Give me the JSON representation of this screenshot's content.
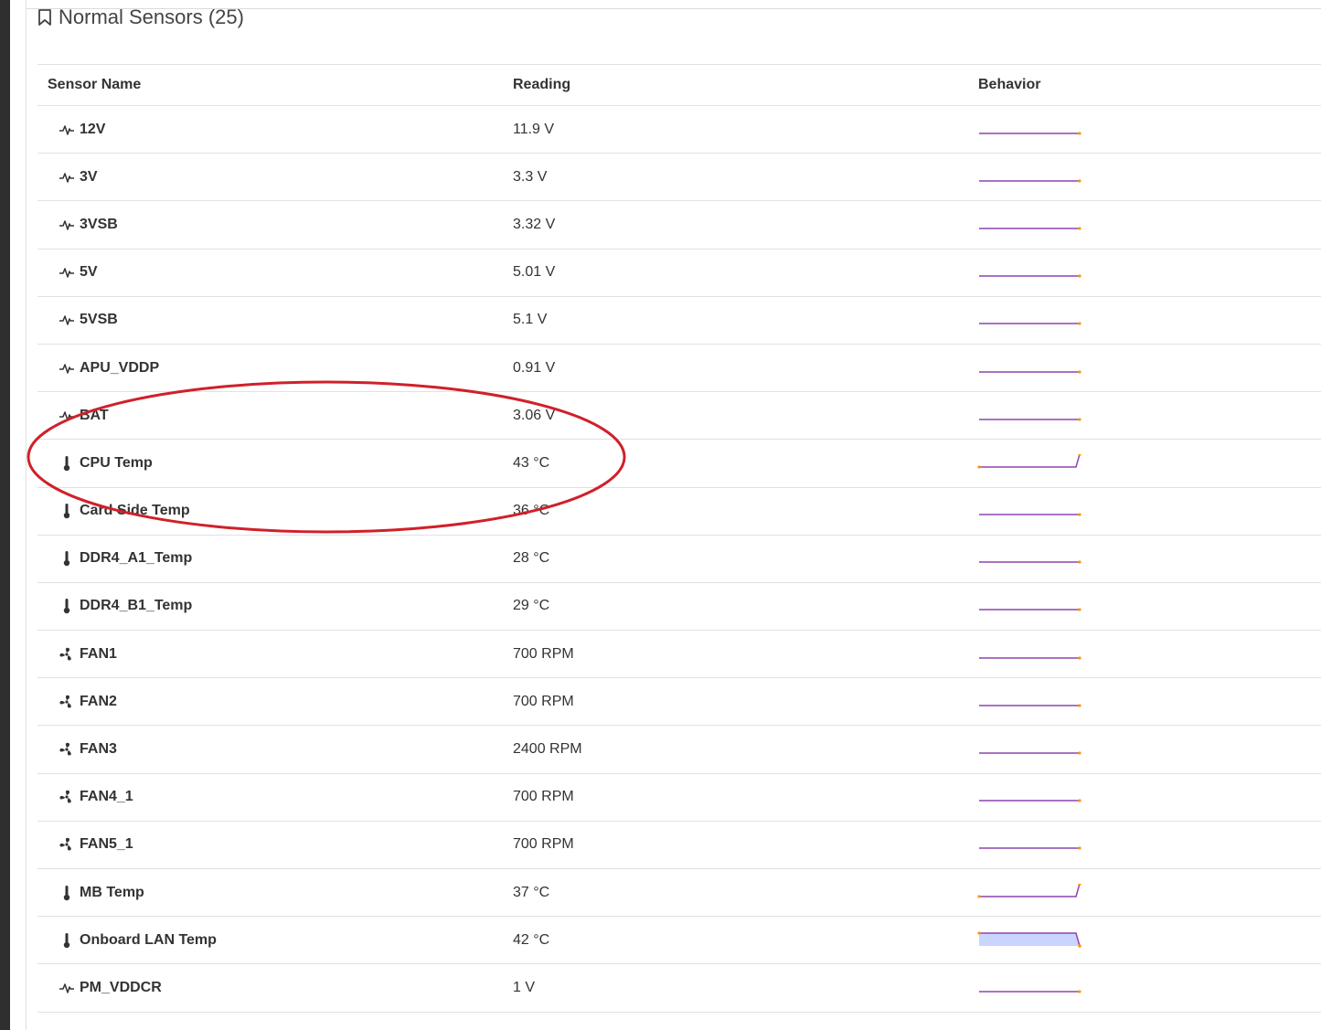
{
  "section": {
    "title": "Normal Sensors (25)"
  },
  "table": {
    "headers": {
      "name": "Sensor Name",
      "reading": "Reading",
      "behavior": "Behavior"
    },
    "rows": [
      {
        "name": "12V",
        "reading": "11.9 V",
        "icon": "voltage-icon",
        "trend": "flat"
      },
      {
        "name": "3V",
        "reading": "3.3 V",
        "icon": "voltage-icon",
        "trend": "flat"
      },
      {
        "name": "3VSB",
        "reading": "3.32 V",
        "icon": "voltage-icon",
        "trend": "flat"
      },
      {
        "name": "5V",
        "reading": "5.01 V",
        "icon": "voltage-icon",
        "trend": "flat"
      },
      {
        "name": "5VSB",
        "reading": "5.1 V",
        "icon": "voltage-icon",
        "trend": "flat"
      },
      {
        "name": "APU_VDDP",
        "reading": "0.91 V",
        "icon": "voltage-icon",
        "trend": "flat"
      },
      {
        "name": "BAT",
        "reading": "3.06 V",
        "icon": "voltage-icon",
        "trend": "flat"
      },
      {
        "name": "CPU Temp",
        "reading": "43 °C",
        "icon": "thermometer-icon",
        "trend": "spike-up"
      },
      {
        "name": "Card Side Temp",
        "reading": "36 °C",
        "icon": "thermometer-icon",
        "trend": "flat"
      },
      {
        "name": "DDR4_A1_Temp",
        "reading": "28 °C",
        "icon": "thermometer-icon",
        "trend": "flat"
      },
      {
        "name": "DDR4_B1_Temp",
        "reading": "29 °C",
        "icon": "thermometer-icon",
        "trend": "flat"
      },
      {
        "name": "FAN1",
        "reading": "700 RPM",
        "icon": "fan-icon",
        "trend": "flat"
      },
      {
        "name": "FAN2",
        "reading": "700 RPM",
        "icon": "fan-icon",
        "trend": "flat"
      },
      {
        "name": "FAN3",
        "reading": "2400 RPM",
        "icon": "fan-icon",
        "trend": "flat"
      },
      {
        "name": "FAN4_1",
        "reading": "700 RPM",
        "icon": "fan-icon",
        "trend": "flat"
      },
      {
        "name": "FAN5_1",
        "reading": "700 RPM",
        "icon": "fan-icon",
        "trend": "flat"
      },
      {
        "name": "MB Temp",
        "reading": "37 °C",
        "icon": "thermometer-icon",
        "trend": "spike-up"
      },
      {
        "name": "Onboard LAN Temp",
        "reading": "42 °C",
        "icon": "thermometer-icon",
        "trend": "area-drop"
      },
      {
        "name": "PM_VDDCR",
        "reading": "1 V",
        "icon": "voltage-icon",
        "trend": "flat"
      }
    ]
  },
  "colors": {
    "sparkline": "#8e44ad",
    "sparkline_fill": "#c9d4ff",
    "sparkline_dot": "#ff9800",
    "annotation": "#d0202a"
  }
}
